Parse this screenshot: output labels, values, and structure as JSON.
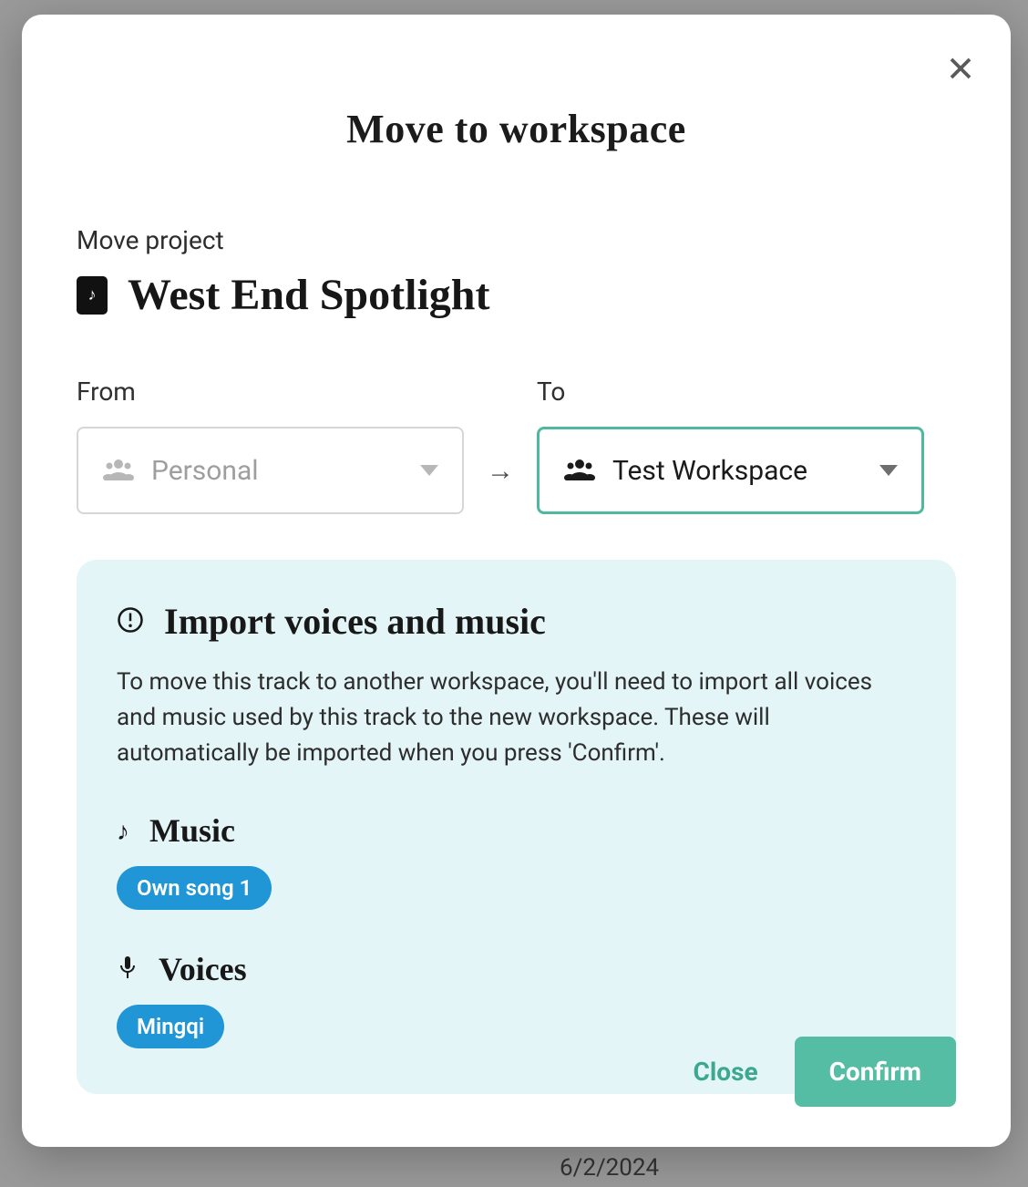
{
  "modal": {
    "title": "Move to workspace",
    "section_label": "Move project",
    "project_name": "West End Spotlight",
    "from_label": "From",
    "to_label": "To",
    "from_value": "Personal",
    "to_value": "Test Workspace",
    "info": {
      "title": "Import voices and music",
      "description": "To move this track to another workspace, you'll need to import all voices and music used by this track to the new workspace. These will automatically be imported when you press 'Confirm'.",
      "music_heading": "Music",
      "music_chips": [
        "Own song 1"
      ],
      "voices_heading": "Voices",
      "voices_chips": [
        "Mingqi"
      ]
    },
    "close_label": "Close",
    "confirm_label": "Confirm"
  },
  "background": {
    "date": "6/2/2024"
  }
}
